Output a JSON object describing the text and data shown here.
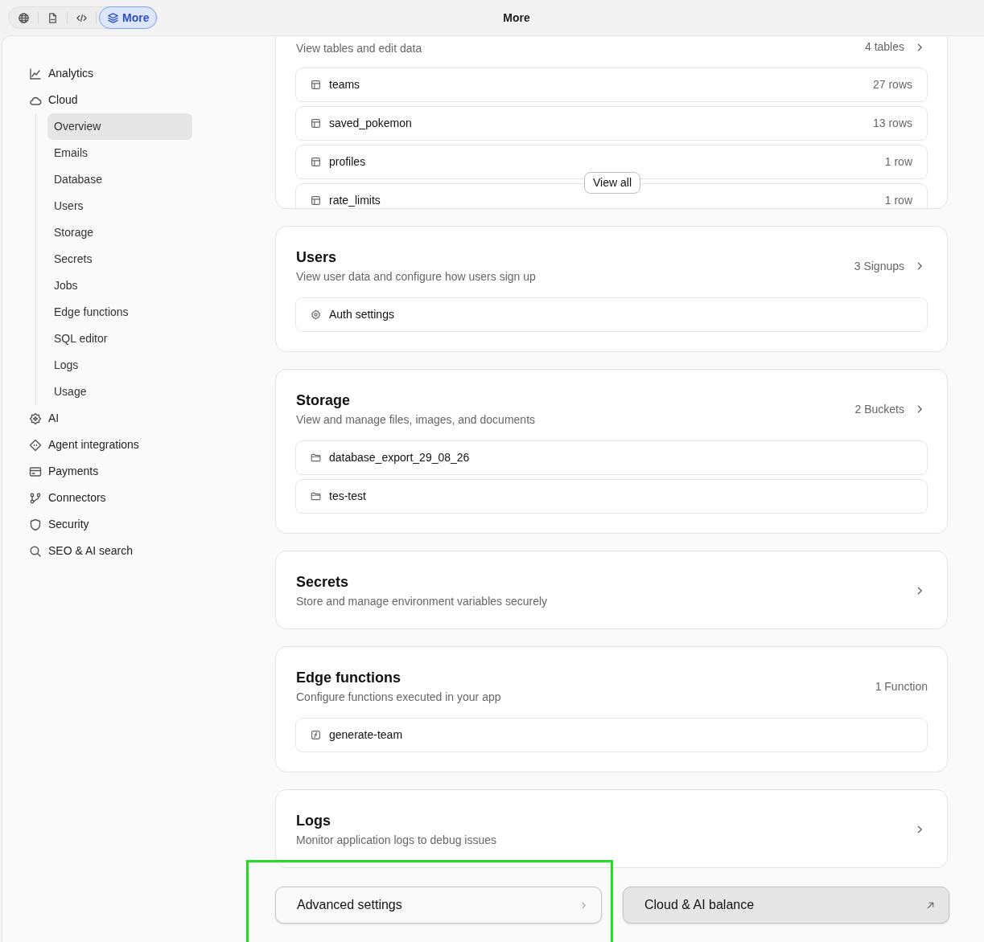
{
  "toolbar": {
    "tabs": [
      {
        "kind": "globe",
        "selected": false
      },
      {
        "kind": "document",
        "selected": false
      },
      {
        "kind": "code",
        "selected": false
      },
      {
        "kind": "layers",
        "label": "More",
        "selected": true
      }
    ],
    "title": "More"
  },
  "sidebar": {
    "items": [
      {
        "label": "Analytics",
        "selected": false
      },
      {
        "label": "Cloud",
        "selected": false,
        "expanded": true,
        "children": [
          {
            "label": "Overview",
            "selected": true
          },
          {
            "label": "Emails",
            "selected": false
          },
          {
            "label": "Database",
            "selected": false
          },
          {
            "label": "Users",
            "selected": false
          },
          {
            "label": "Storage",
            "selected": false
          },
          {
            "label": "Secrets",
            "selected": false
          },
          {
            "label": "Jobs",
            "selected": false
          },
          {
            "label": "Edge functions",
            "selected": false
          },
          {
            "label": "SQL editor",
            "selected": false
          },
          {
            "label": "Logs",
            "selected": false
          },
          {
            "label": "Usage",
            "selected": false
          }
        ]
      },
      {
        "label": "AI",
        "selected": false
      },
      {
        "label": "Agent integrations",
        "selected": false
      },
      {
        "label": "Payments",
        "selected": false
      },
      {
        "label": "Connectors",
        "selected": false
      },
      {
        "label": "Security",
        "selected": false
      },
      {
        "label": "SEO & AI search",
        "selected": false
      }
    ]
  },
  "sections": [
    {
      "kind": "database",
      "subtitle": "View tables and edit data",
      "count": "4 tables",
      "link": true,
      "view_all": "View all",
      "items": [
        {
          "label": "teams",
          "meta": "27 rows"
        },
        {
          "label": "saved_pokemon",
          "meta": "13 rows"
        },
        {
          "label": "profiles",
          "meta": "1 row"
        },
        {
          "label": "rate_limits",
          "meta": "1 row"
        }
      ]
    },
    {
      "kind": "users",
      "title": "Users",
      "subtitle": "View user data and configure how users sign up",
      "count": "3 Signups",
      "link": true,
      "items": [
        {
          "label": "Auth settings"
        }
      ]
    },
    {
      "kind": "storage",
      "title": "Storage",
      "subtitle": "View and manage files, images, and documents",
      "count": "2 Buckets",
      "link": true,
      "items": [
        {
          "label": "database_export_29_08_26"
        },
        {
          "label": "tes-test"
        }
      ]
    },
    {
      "kind": "secrets",
      "title": "Secrets",
      "subtitle": "Store and manage environment variables securely",
      "link": true
    },
    {
      "kind": "functions",
      "title": "Edge functions",
      "subtitle": "Configure functions executed in your app",
      "count": "1 Function",
      "link": false,
      "items": [
        {
          "label": "generate-team"
        }
      ]
    },
    {
      "kind": "logs",
      "title": "Logs",
      "subtitle": "Monitor application logs to debug issues",
      "link": true
    }
  ],
  "footer_buttons": [
    {
      "kind": "internal",
      "label": "Advanced settings",
      "highlighted": true
    },
    {
      "kind": "external",
      "label": "Cloud & AI balance",
      "highlighted": false
    }
  ]
}
